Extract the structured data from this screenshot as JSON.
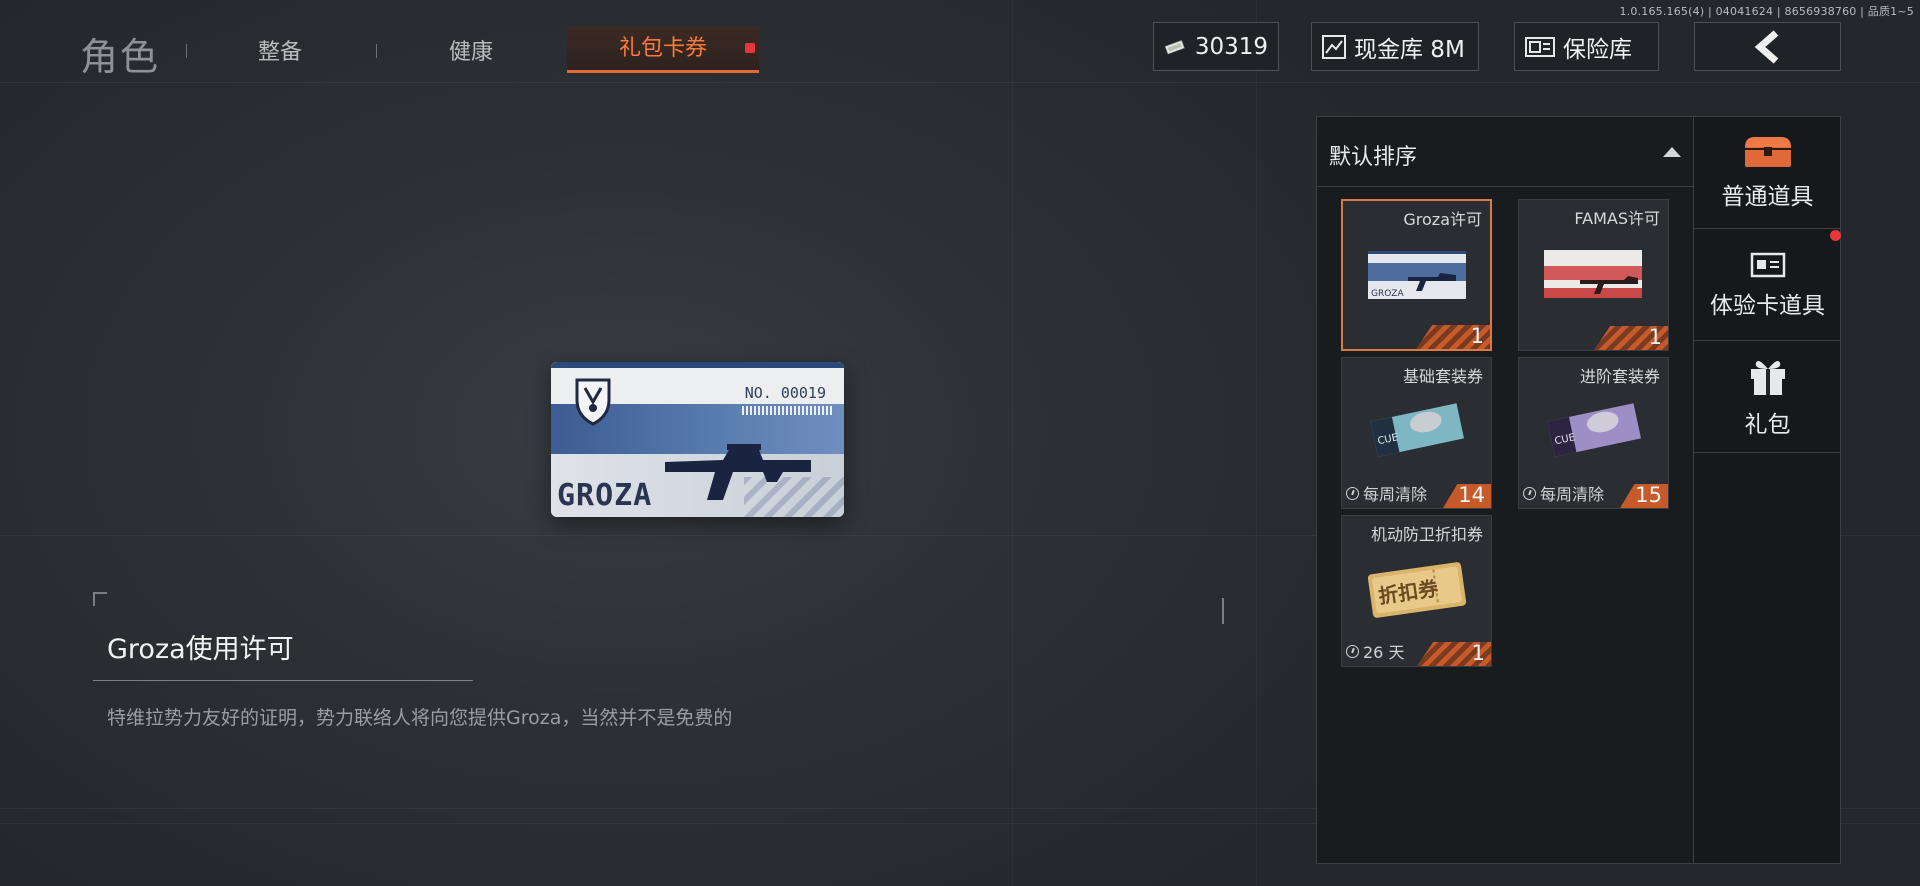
{
  "version": "1.0.165.165(4) | 04041624 | 8656938760 | 品质1~5",
  "header": {
    "role_tab": "角色",
    "tabs": [
      {
        "label": "整备"
      },
      {
        "label": "健康"
      },
      {
        "label": "礼包卡券"
      }
    ],
    "currency": "30319",
    "cash_vault": "现金库 8M",
    "safe_vault": "保险库"
  },
  "ticket": {
    "number": "NO. 00019",
    "name": "GROZA"
  },
  "detail": {
    "title": "Groza使用许可",
    "description": "特维拉势力友好的证明，势力联络人将向您提供Groza，当然并不是免费的"
  },
  "inventory": {
    "sort_label": "默认排序",
    "items": [
      {
        "name": "Groza许可",
        "count": "1",
        "timer": ""
      },
      {
        "name": "FAMAS许可",
        "count": "1",
        "timer": ""
      },
      {
        "name": "基础套装券",
        "count": "14",
        "timer": "每周清除"
      },
      {
        "name": "进阶套装券",
        "count": "15",
        "timer": "每周清除"
      },
      {
        "name": "机动防卫折扣券",
        "count": "1",
        "timer": "26 天"
      }
    ]
  },
  "categories": [
    {
      "label": "普通道具",
      "icon": "chest-icon"
    },
    {
      "label": "体验卡道具",
      "icon": "id-card-icon"
    },
    {
      "label": "礼包",
      "icon": "gift-icon"
    }
  ],
  "colors": {
    "accent": "#e06a35",
    "count_badge": "#c65a2b",
    "notify_dot": "#e8373c"
  }
}
